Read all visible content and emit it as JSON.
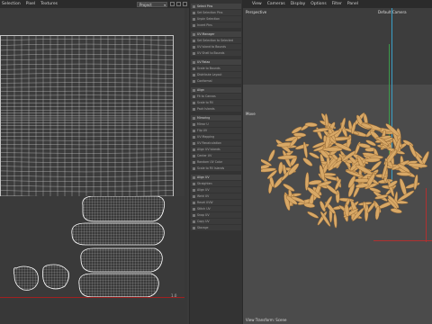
{
  "uv_editor": {
    "menu": [
      "Selection",
      "Pixel",
      "Textures"
    ],
    "projection_mode": "Project",
    "zoom_label": "1.0"
  },
  "sidebar": {
    "sections": [
      {
        "header": "Select Pins",
        "items": [
          "Set Selection Pins",
          "Unpin Selection",
          "Invert Pins"
        ]
      },
      {
        "header": "UV Manager",
        "items": [
          "Set Selection to Selected",
          "UV Island to Bounds",
          "UV Shell to Bounds"
        ]
      },
      {
        "header": "UV Relax",
        "items": [
          "Scale to Bounds",
          "Distribute Layout",
          "Conformal"
        ]
      },
      {
        "header": "Align",
        "items": [
          "Fit to Canvas",
          "Scale to Fill",
          "Pack Islands"
        ]
      },
      {
        "header": "Mirroring",
        "items": [
          "Mirror U",
          "Flip UV",
          "UV Mapping",
          "UV Recalculation",
          "Align UV Islands",
          "Center UV",
          "Random UV Color",
          "Scale to Fill Islands"
        ]
      },
      {
        "header": "Align UV",
        "items": [
          "Straighten",
          "Align UV",
          "Weld UV",
          "Reset UVW",
          "Stitch UV",
          "Snap UV",
          "Copy UV",
          "Storage"
        ]
      }
    ]
  },
  "viewport": {
    "menu": [
      "View",
      "Cameras",
      "Display",
      "Options",
      "Filter",
      "Panel"
    ],
    "view_name": "Perspective",
    "camera": "Default Camera",
    "move_label": "Move",
    "status": "View Transform: Scene"
  },
  "colors": {
    "rice_fill": "#d8a866",
    "rice_stroke": "#8a5e2c",
    "axis_y": "#3aa0c8",
    "axis_z": "#3c9a4a",
    "axis_x": "#b03030"
  }
}
